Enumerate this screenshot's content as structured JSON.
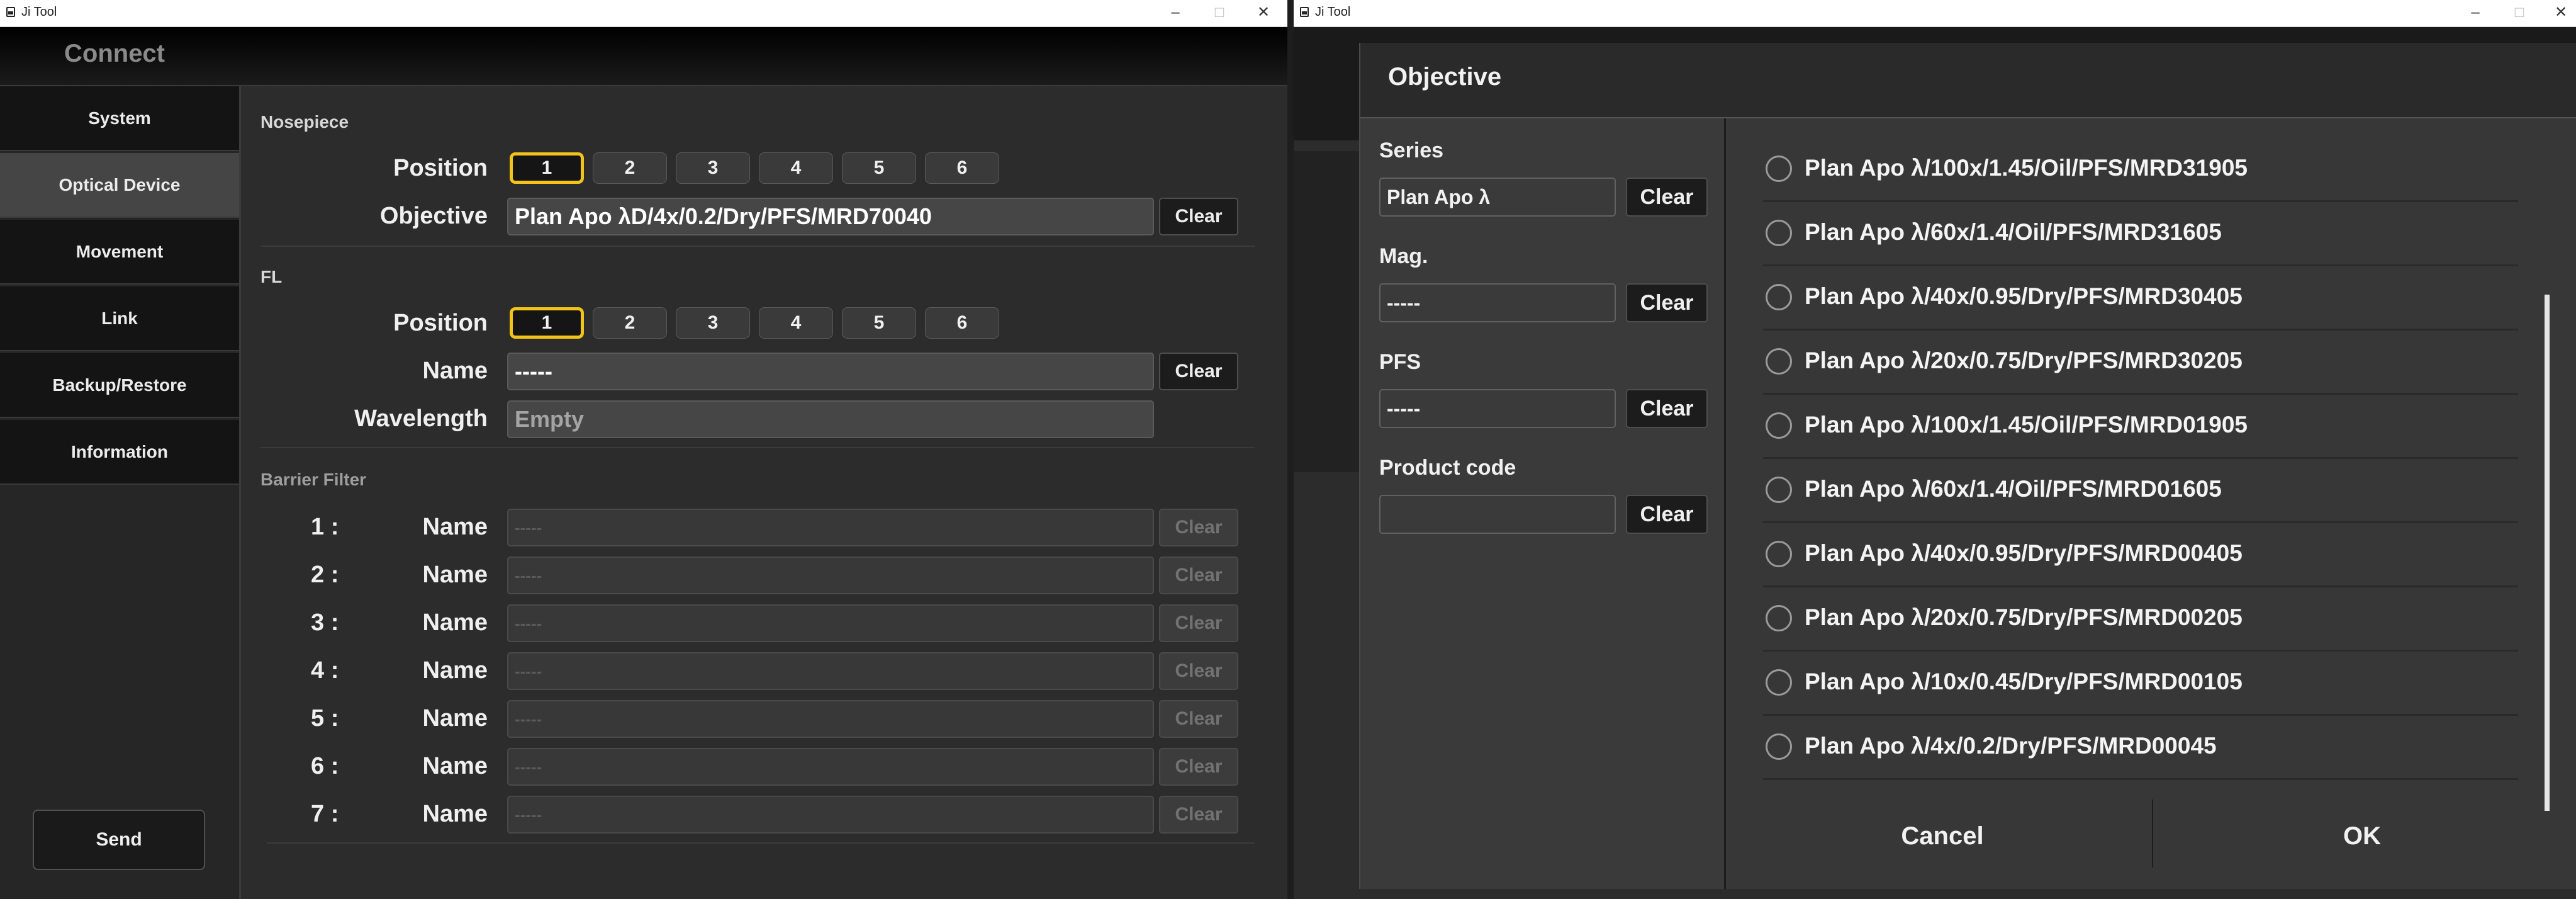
{
  "left_window": {
    "title": "Ji Tool",
    "header": "Connect",
    "nav": [
      "System",
      "Optical Device",
      "Movement",
      "Link",
      "Backup/Restore",
      "Information"
    ],
    "send_label": "Send",
    "nosepiece": {
      "section": "Nosepiece",
      "position_label": "Position",
      "positions": [
        "1",
        "2",
        "3",
        "4",
        "5",
        "6"
      ],
      "objective_label": "Objective",
      "objective_value": "Plan Apo λD/4x/0.2/Dry/PFS/MRD70040",
      "clear": "Clear"
    },
    "fl": {
      "section": "FL",
      "position_label": "Position",
      "positions": [
        "1",
        "2",
        "3",
        "4",
        "5",
        "6"
      ],
      "name_label": "Name",
      "name_value": "-----",
      "wavelength_label": "Wavelength",
      "wavelength_value": "Empty",
      "clear": "Clear"
    },
    "barrier": {
      "section": "Barrier Filter",
      "rows": [
        {
          "num": "1 :",
          "label": "Name",
          "value": "-----",
          "clear": "Clear"
        },
        {
          "num": "2 :",
          "label": "Name",
          "value": "-----",
          "clear": "Clear"
        },
        {
          "num": "3 :",
          "label": "Name",
          "value": "-----",
          "clear": "Clear"
        },
        {
          "num": "4 :",
          "label": "Name",
          "value": "-----",
          "clear": "Clear"
        },
        {
          "num": "5 :",
          "label": "Name",
          "value": "-----",
          "clear": "Clear"
        },
        {
          "num": "6 :",
          "label": "Name",
          "value": "-----",
          "clear": "Clear"
        },
        {
          "num": "7 :",
          "label": "Name",
          "value": "-----",
          "clear": "Clear"
        }
      ]
    }
  },
  "right_window": {
    "title": "Ji Tool",
    "dialog": {
      "title": "Objective",
      "filters": {
        "series_label": "Series",
        "series_value": "Plan Apo λ",
        "mag_label": "Mag.",
        "mag_value": "-----",
        "pfs_label": "PFS",
        "pfs_value": "-----",
        "product_label": "Product code",
        "product_value": "",
        "clear": "Clear"
      },
      "items": [
        "Plan Apo λ/100x/1.45/Oil/PFS/MRD31905",
        "Plan Apo λ/60x/1.4/Oil/PFS/MRD31605",
        "Plan Apo λ/40x/0.95/Dry/PFS/MRD30405",
        "Plan Apo λ/20x/0.75/Dry/PFS/MRD30205",
        "Plan Apo λ/100x/1.45/Oil/PFS/MRD01905",
        "Plan Apo λ/60x/1.4/Oil/PFS/MRD01605",
        "Plan Apo λ/40x/0.95/Dry/PFS/MRD00405",
        "Plan Apo λ/20x/0.75/Dry/PFS/MRD00205",
        "Plan Apo λ/10x/0.45/Dry/PFS/MRD00105",
        "Plan Apo λ/4x/0.2/Dry/PFS/MRD00045"
      ],
      "cancel": "Cancel",
      "ok": "OK"
    }
  },
  "colors": {
    "highlight": "#f2c318",
    "background": "#2c2c2c",
    "active_nav": "#454545"
  }
}
